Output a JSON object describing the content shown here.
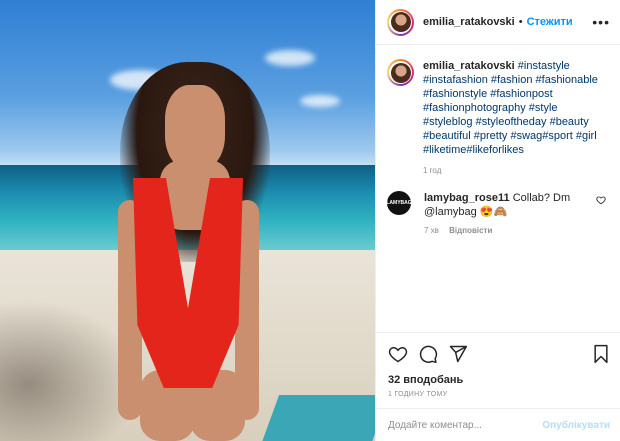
{
  "post": {
    "author": "emilia_ratakovski",
    "follow_label": "Стежити",
    "separator": "•",
    "more_label": "•••",
    "caption": {
      "author": "emilia_ratakovski",
      "hashtags_text": "#instastyle #instafashion #fashion #fashionable #fashionstyle #fashionpost #fashionphotography #style #styleblog #styleoftheday #beauty #beautiful #pretty #swag#sport #girl #liketime#likeforlikes",
      "time": "1 год"
    },
    "comments": [
      {
        "author": "lamybag_rose11",
        "text": "Collab? Dm @lamybag 😍🙈",
        "avatar_text": "LAMYBAG",
        "time": "7 хв",
        "reply_label": "Відповісти"
      }
    ],
    "likes": "32 вподобань",
    "posted": "1 ГОДИНУ ТОМУ",
    "comment_placeholder": "Додайте коментар...",
    "publish_label": "Опублікувати"
  },
  "icons": {
    "like": "heart-icon",
    "comment": "comment-icon",
    "share": "paper-plane-icon",
    "save": "bookmark-icon"
  },
  "colors": {
    "accent": "#0095f6",
    "publish_disabled": "#b2dffc",
    "swimsuit": "#e4251b"
  }
}
